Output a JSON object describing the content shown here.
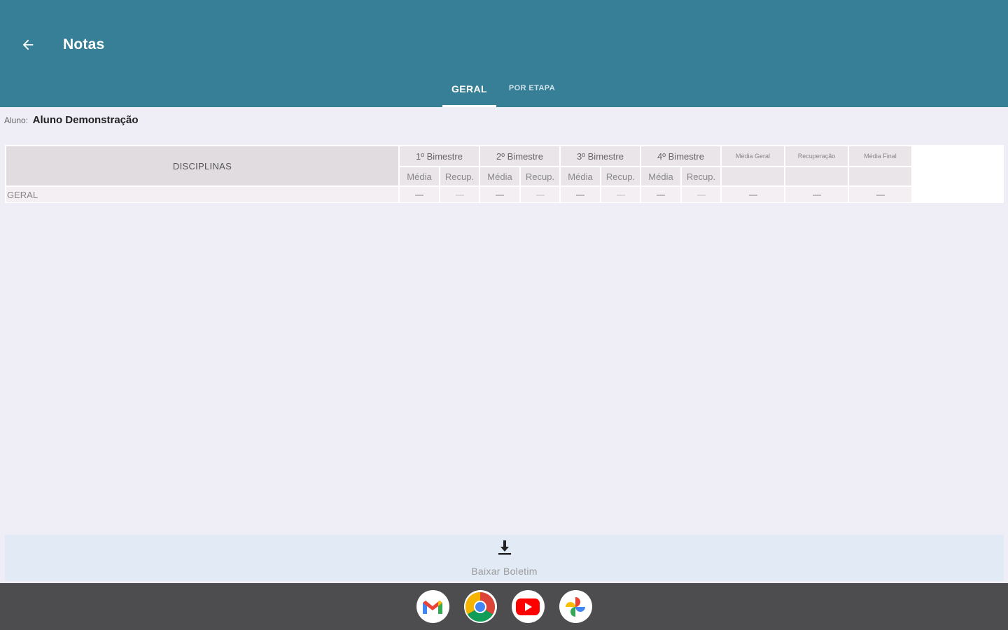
{
  "appbar": {
    "title": "Notas",
    "back_icon": "arrow-left-icon",
    "background": "#377f96"
  },
  "tabs": [
    {
      "label": "GERAL",
      "active": true
    },
    {
      "label": "POR ETAPA",
      "active": false
    }
  ],
  "student": {
    "label": "Aluno:",
    "name": "Aluno Demonstração"
  },
  "table": {
    "disciplines_header": "DISCIPLINAS",
    "periods": [
      "1º Bimestre",
      "2º Bimestre",
      "3º Bimestre",
      "4º Bimestre"
    ],
    "sub_headers": {
      "media": "Média",
      "recup": "Recup."
    },
    "extra_columns": [
      "Média Geral",
      "Recuperação",
      "Média Final"
    ],
    "rows": [
      {
        "discipline": "GERAL",
        "values": [
          "—",
          "—",
          "—",
          "—",
          "—",
          "—",
          "—",
          "—",
          "—",
          "—",
          "—"
        ]
      }
    ]
  },
  "download": {
    "label": "Baixar Boletim",
    "icon": "download-icon"
  },
  "dock": {
    "apps": [
      "gmail-icon",
      "chrome-icon",
      "youtube-icon",
      "photos-icon"
    ]
  }
}
